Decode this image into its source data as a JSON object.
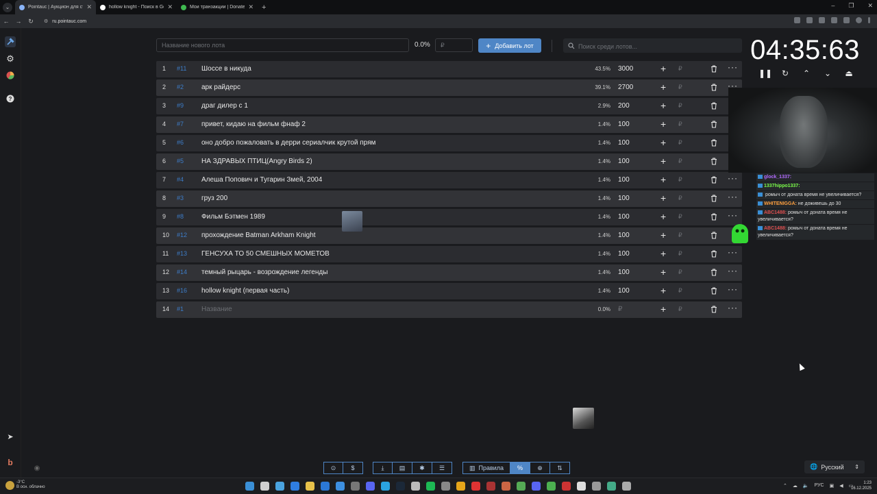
{
  "browser": {
    "tabs": [
      {
        "title": "Pointauc | Аукцион для стрима",
        "active": true,
        "favicon_color": "#8ab4f8"
      },
      {
        "title": "hollow knight - Поиск в Google",
        "active": false,
        "favicon_color": "#ffffff"
      },
      {
        "title": "Мои транзакции | DonatePay",
        "active": false,
        "favicon_color": "#3fb950"
      }
    ],
    "url": "ru.pointauc.com"
  },
  "controls": {
    "new_lot_placeholder": "Название нового лота",
    "percent": "0.0%",
    "amount_placeholder": "₽",
    "add_button": "Добавить лот",
    "search_placeholder": "Поиск среди лотов..."
  },
  "lots": [
    {
      "index": "1",
      "id": "#11",
      "name": "Шоссе в никуда",
      "percent": "43.5%",
      "amount": "3000",
      "rub": "₽",
      "more": "···"
    },
    {
      "index": "2",
      "id": "#2",
      "name": "арк райдерс",
      "percent": "39.1%",
      "amount": "2700",
      "rub": "₽",
      "more": "···"
    },
    {
      "index": "3",
      "id": "#9",
      "name": "драг дилер с 1",
      "percent": "2.9%",
      "amount": "200",
      "rub": "₽",
      "more": ""
    },
    {
      "index": "4",
      "id": "#7",
      "name": "привет, кидаю на фильм фнаф 2",
      "percent": "1.4%",
      "amount": "100",
      "rub": "₽",
      "more": ""
    },
    {
      "index": "5",
      "id": "#6",
      "name": "оно добро пожаловать в дерри сериалчик крутой прям",
      "percent": "1.4%",
      "amount": "100",
      "rub": "₽",
      "more": ""
    },
    {
      "index": "6",
      "id": "#5",
      "name": "НА ЗДРАВЫХ ПТИЦ(Angry Birds 2)",
      "percent": "1.4%",
      "amount": "100",
      "rub": "₽",
      "more": ""
    },
    {
      "index": "7",
      "id": "#4",
      "name": "Алеша Попович и Тугарин Змей, 2004",
      "percent": "1.4%",
      "amount": "100",
      "rub": "₽",
      "more": "···"
    },
    {
      "index": "8",
      "id": "#3",
      "name": "груз 200",
      "percent": "1.4%",
      "amount": "100",
      "rub": "₽",
      "more": "···"
    },
    {
      "index": "9",
      "id": "#8",
      "name": "Фильм Бэтмен 1989",
      "percent": "1.4%",
      "amount": "100",
      "rub": "₽",
      "more": "···"
    },
    {
      "index": "10",
      "id": "#12",
      "name": "прохождение Batman Arkham Knight",
      "percent": "1.4%",
      "amount": "100",
      "rub": "₽",
      "more": ""
    },
    {
      "index": "11",
      "id": "#13",
      "name": "ГЕНСУХА ТО 50 СМЕШНЫХ МОМЕТОВ",
      "percent": "1.4%",
      "amount": "100",
      "rub": "₽",
      "more": "···"
    },
    {
      "index": "12",
      "id": "#14",
      "name": "темный рыцарь - возрождение легенды",
      "percent": "1.4%",
      "amount": "100",
      "rub": "₽",
      "more": "···"
    },
    {
      "index": "13",
      "id": "#16",
      "name": "hollow knight (первая часть)",
      "percent": "1.4%",
      "amount": "100",
      "rub": "₽",
      "more": "···"
    },
    {
      "index": "14",
      "id": "#1",
      "name": "Название",
      "percent": "0.0%",
      "amount": "₽",
      "rub": "₽",
      "more": "···",
      "placeholder": true
    }
  ],
  "timer": {
    "value": "04:35:63"
  },
  "chat": [
    {
      "user": "glock_1337:",
      "user_color": "#b36bff",
      "text": ""
    },
    {
      "user": "1337hippo1337:",
      "user_color": "#7cff4a",
      "text": ""
    },
    {
      "user": "",
      "user_color": "#e05050",
      "text": "ромыч от доната время не увеличивается?"
    },
    {
      "user": "WHITENIGGA:",
      "user_color": "#ffa040",
      "text": "не доживешь до 30"
    },
    {
      "user": "ABC1488:",
      "user_color": "#e05050",
      "text": "ромыч от доната время не увеличивается?"
    },
    {
      "user": "ABC1488:",
      "user_color": "#e05050",
      "text": "ромыч от доната время не увеличивается?"
    }
  ],
  "bottom_toolbar": {
    "rules_label": "Правила"
  },
  "language": {
    "selected": "Русский"
  },
  "taskbar": {
    "weather_temp": "-3°C",
    "weather_desc": "В осн. облачно",
    "lang": "РУС",
    "time": "1:23",
    "date": "16.12.2025"
  },
  "colors": {
    "accent": "#4f86c6",
    "background": "#1a1b1e",
    "row": "#2b2c30"
  }
}
